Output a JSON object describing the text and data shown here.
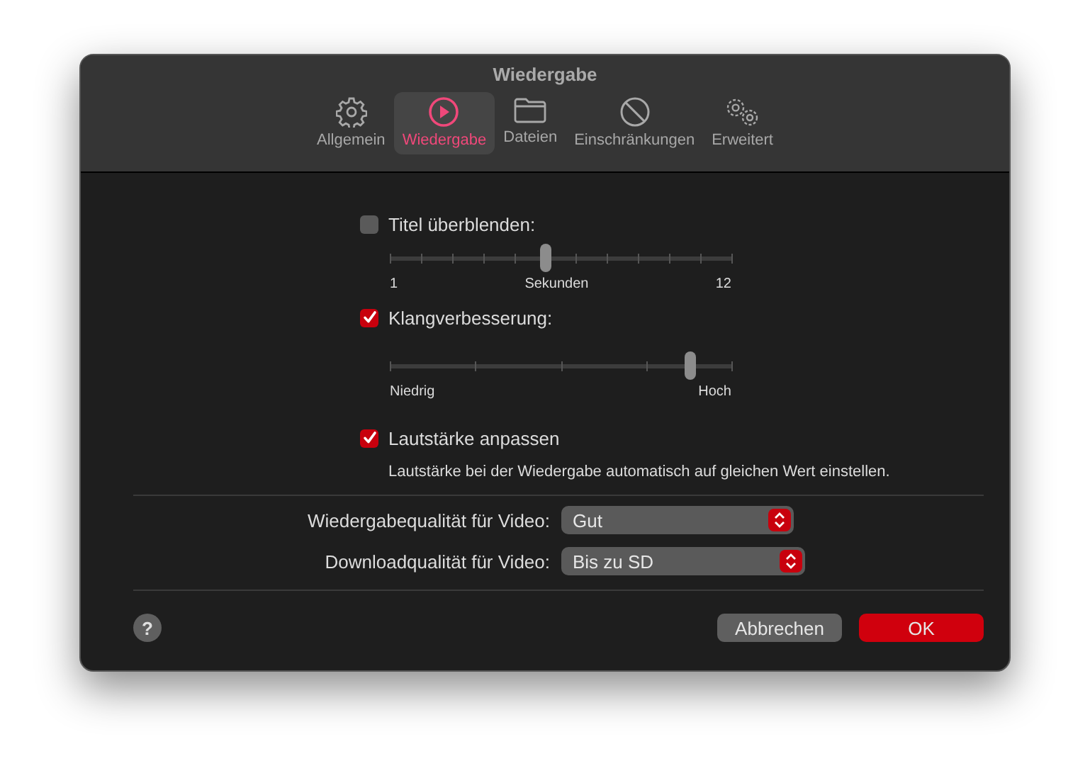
{
  "window": {
    "title": "Wiedergabe"
  },
  "tabs": [
    {
      "label": "Allgemein",
      "kind": "gear",
      "selected": false
    },
    {
      "label": "Wiedergabe",
      "kind": "play",
      "selected": true
    },
    {
      "label": "Dateien",
      "kind": "folder",
      "selected": false
    },
    {
      "label": "Einschränkungen",
      "kind": "prohibit",
      "selected": false
    },
    {
      "label": "Erweitert",
      "kind": "gears",
      "selected": false
    }
  ],
  "settings": [
    {
      "kind": "checkbox",
      "label": "Titel überblenden:",
      "checked": false
    },
    {
      "kind": "slider",
      "level": 0.4545,
      "labels": [
        "1",
        "Sekunden",
        "12"
      ]
    },
    {
      "kind": "checkbox",
      "label": "Klangverbesserung:",
      "checked": true
    },
    {
      "kind": "slider",
      "level": 0.88,
      "labels": [
        "Niedrig",
        "Hoch"
      ]
    },
    {
      "kind": "checkbox",
      "label": "Lautstärke anpassen",
      "checked": true,
      "description": "Lautstärke bei der Wiedergabe automatisch auf gleichen Wert einstellen."
    }
  ],
  "popups": [
    {
      "label": "Wiedergabequalität für Video:",
      "value": "Gut"
    },
    {
      "label": "Downloadqualität für Video:",
      "value": "Bis zu SD"
    }
  ],
  "help": {
    "label": "?"
  },
  "buttons": [
    {
      "label": "Abbrechen",
      "kind": "normal"
    },
    {
      "label": "OK",
      "kind": "default"
    }
  ]
}
